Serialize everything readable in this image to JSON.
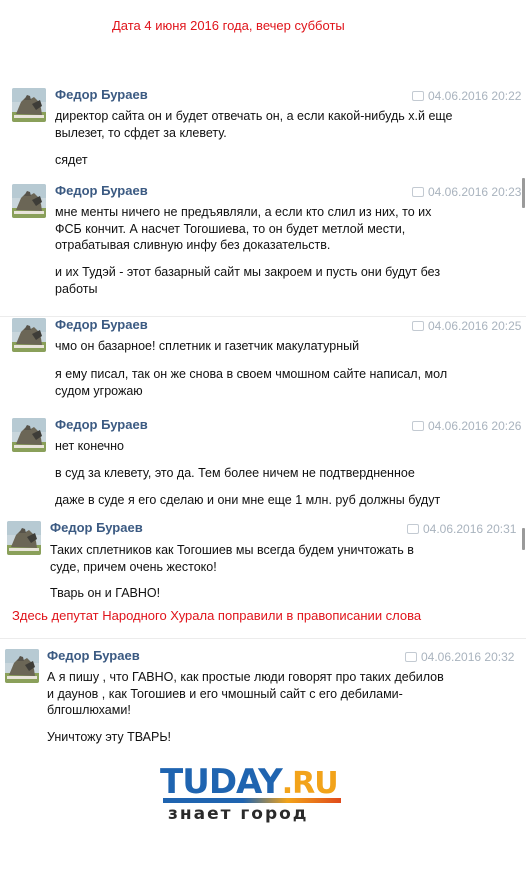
{
  "captions": {
    "top": "Дата 4 июня 2016 года, вечер субботы",
    "middle": "Здесь депутат Народного Хурала поправили в правописании слова"
  },
  "messages": [
    {
      "author": "Федор Бураев",
      "date": "04.06.2016 20:22",
      "paragraphs": [
        [
          "директор сайта он и будет отвечать он, а если какой-нибудь х.й еще",
          "вылезет, то сфдет за клевету."
        ],
        [
          "сядет"
        ]
      ]
    },
    {
      "author": "Федор Бураев",
      "date": "04.06.2016 20:23",
      "paragraphs": [
        [
          "мне менты ничего не предъявляли, а если кто слил из них, то их",
          "ФСБ кончит. А насчет Тогошиева, то он будет метлой мести,",
          "отрабатывая сливную инфу без доказательств."
        ],
        [
          "и их Тудэй - этот базарный сайт мы закроем и пусть они будут без",
          "работы"
        ]
      ]
    },
    {
      "author": "Федор Бураев",
      "date": "04.06.2016 20:25",
      "paragraphs": [
        [
          "чмо он базарное! сплетник и газетчик макулатурный"
        ],
        [
          "я ему писал, так он же снова в своем чмошном сайте написал, мол",
          "судом угрожаю"
        ]
      ]
    },
    {
      "author": "Федор Бураев",
      "date": "04.06.2016 20:26",
      "paragraphs": [
        [
          "нет конечно"
        ],
        [
          "в суд за клевету, это да. Тем более ничем не подтвердненное"
        ],
        [
          "даже в суде я его сделаю и они мне еще 1 млн. руб должны будут"
        ]
      ]
    },
    {
      "author": "Федор Бураев",
      "date": "04.06.2016 20:31",
      "paragraphs": [
        [
          "Таких сплетников как Тогошиев мы всегда будем уничтожать в",
          "суде, причем очень жестоко!"
        ],
        [
          "Тварь он и ГАВНО!"
        ]
      ]
    },
    {
      "author": "Федор Бураев",
      "date": "04.06.2016 20:32",
      "paragraphs": [
        [
          "А я пишу , что ГАВНО, как простые люди говорят про таких дебилов",
          "и даунов , как Тогошиев и его чмошный сайт с его дебилами-",
          "блгошлюхами!"
        ],
        [
          "Уничтожу эту ТВАРЬ!"
        ]
      ]
    }
  ],
  "logo": {
    "tu": "TU",
    "day": "DAY",
    "ru": ".RU",
    "tagline": "знает город"
  },
  "colors": {
    "caption": "#e0141b",
    "author": "#3b5a82",
    "date": "#a9b3be",
    "logo_blue": "#1f64b0",
    "logo_orange": "#f2a31a"
  },
  "icons": {
    "avatar": "statue-photo-avatar",
    "date": "speech-bubble-icon"
  }
}
